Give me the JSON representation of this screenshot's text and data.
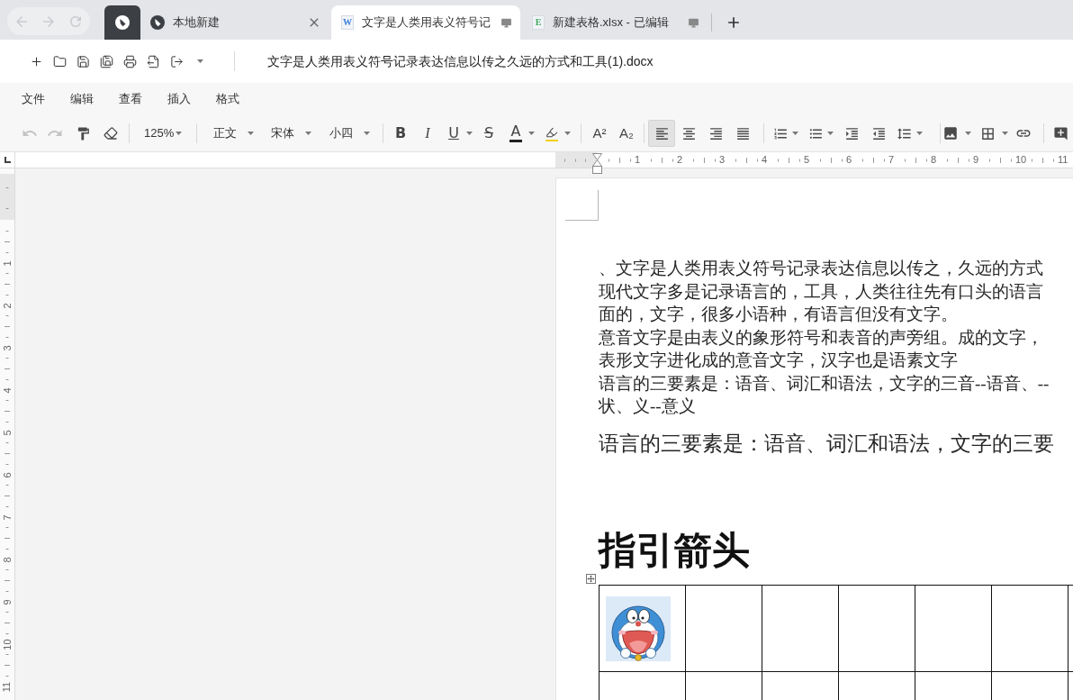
{
  "browser": {
    "nav": [
      {
        "kind": "back",
        "disabled": true
      },
      {
        "kind": "forward",
        "disabled": true
      },
      {
        "kind": "reload",
        "disabled": true
      }
    ],
    "tabs": [
      {
        "kind": "home",
        "selected": false
      },
      {
        "kind": "start",
        "title": "本地新建",
        "selected": false
      },
      {
        "kind": "file",
        "badge": "W",
        "color": "#3f7fd8",
        "title": "文字是人类用表义符号记",
        "selected": true
      },
      {
        "kind": "file",
        "badge": "E",
        "color": "#3aa856",
        "title": "新建表格.xlsx - 已编辑",
        "selected": false
      }
    ]
  },
  "document_title": "文字是人类用表义符号记录表达信息以传之久远的方式和工具(1).docx",
  "menu": [
    "文件",
    "编辑",
    "查看",
    "插入",
    "格式"
  ],
  "toolbar": {
    "history": [
      {
        "kind": "undo",
        "disabled": true
      },
      {
        "kind": "redo",
        "disabled": true
      }
    ],
    "zoom": "125%",
    "style": "正文",
    "font": "宋体",
    "size": "小四",
    "text_format": [
      {
        "kind": "bold",
        "label": "B"
      },
      {
        "kind": "italic",
        "label": "I"
      },
      {
        "kind": "underline",
        "label": "U"
      },
      {
        "kind": "strikethrough",
        "label": "S"
      },
      {
        "kind": "font_color",
        "label": "A"
      }
    ],
    "script": [
      {
        "kind": "superscript",
        "label": "A²"
      },
      {
        "kind": "subscript",
        "label": "A₂"
      }
    ],
    "align": [
      {
        "kind": "left",
        "selected": true
      },
      {
        "kind": "center",
        "selected": false
      },
      {
        "kind": "right",
        "selected": false
      },
      {
        "kind": "justify",
        "selected": false
      }
    ]
  },
  "ruler": {
    "horizontal": [
      "1",
      "2",
      "3",
      "4",
      "5",
      "6",
      "7",
      "8",
      "9",
      "10",
      "11"
    ],
    "vertical": [
      "1",
      "2",
      "3",
      "4",
      "5",
      "6",
      "7",
      "8",
      "9",
      "10",
      "11"
    ]
  },
  "page": {
    "lines": [
      "、文字是人类用表义符号记录表达信息以传之，久远的方式",
      "现代文字多是记录语言的，工具，人类往往先有口头的语言",
      "面的，文字，很多小语种，有语言但没有文字。",
      "意音文字是由表义的象形符号和表音的声旁组。成的文字，",
      "表形文字进化成的意音文字，汉字也是语素文字",
      "语言的三要素是：语音、词汇和语法，文字的三音--语音、--",
      "状、义--意义"
    ],
    "large_line": "语言的三要素是：语音、词汇和语法，文字的三要",
    "heading": "指引箭头",
    "table": {
      "rows": [
        {
          "cells": [
            {
              "kind": "picture"
            },
            {
              "kind": "blank"
            },
            {
              "kind": "blank"
            },
            {
              "kind": "blank"
            },
            {
              "kind": "blank"
            },
            {
              "kind": "blank"
            },
            {
              "kind": "blank"
            }
          ]
        },
        {
          "cells": [
            {
              "kind": "blank"
            },
            {
              "kind": "blank"
            },
            {
              "kind": "blank"
            },
            {
              "kind": "blank"
            },
            {
              "kind": "blank"
            },
            {
              "kind": "blank"
            },
            {
              "kind": "blank"
            }
          ]
        }
      ]
    }
  }
}
